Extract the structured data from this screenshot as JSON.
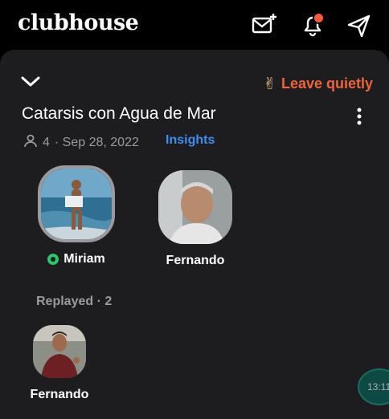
{
  "app": {
    "logo_text": "clubhouse"
  },
  "topbar": {
    "icons": [
      "mail-plus-icon",
      "bell-icon",
      "paper-plane-icon"
    ],
    "notification_color": "#ff5a3c"
  },
  "room": {
    "leave_emoji": "✌",
    "leave_label": "Leave quietly",
    "title": "Catarsis con Agua de Mar",
    "listener_count": "4",
    "date": "· Sep 28, 2022",
    "insights_label": "Insights"
  },
  "speakers": [
    {
      "name": "Miriam",
      "live": true
    },
    {
      "name": "Fernando",
      "live": false
    }
  ],
  "replayed": {
    "label": "Replayed · 2",
    "people": [
      {
        "name": "Fernando"
      }
    ]
  },
  "overlay": {
    "time": "13:11"
  },
  "colors": {
    "accent_orange": "#f0643a",
    "link_blue": "#3f8ef6",
    "live_green": "#2cc66c",
    "panel": "#1d1d1f"
  }
}
